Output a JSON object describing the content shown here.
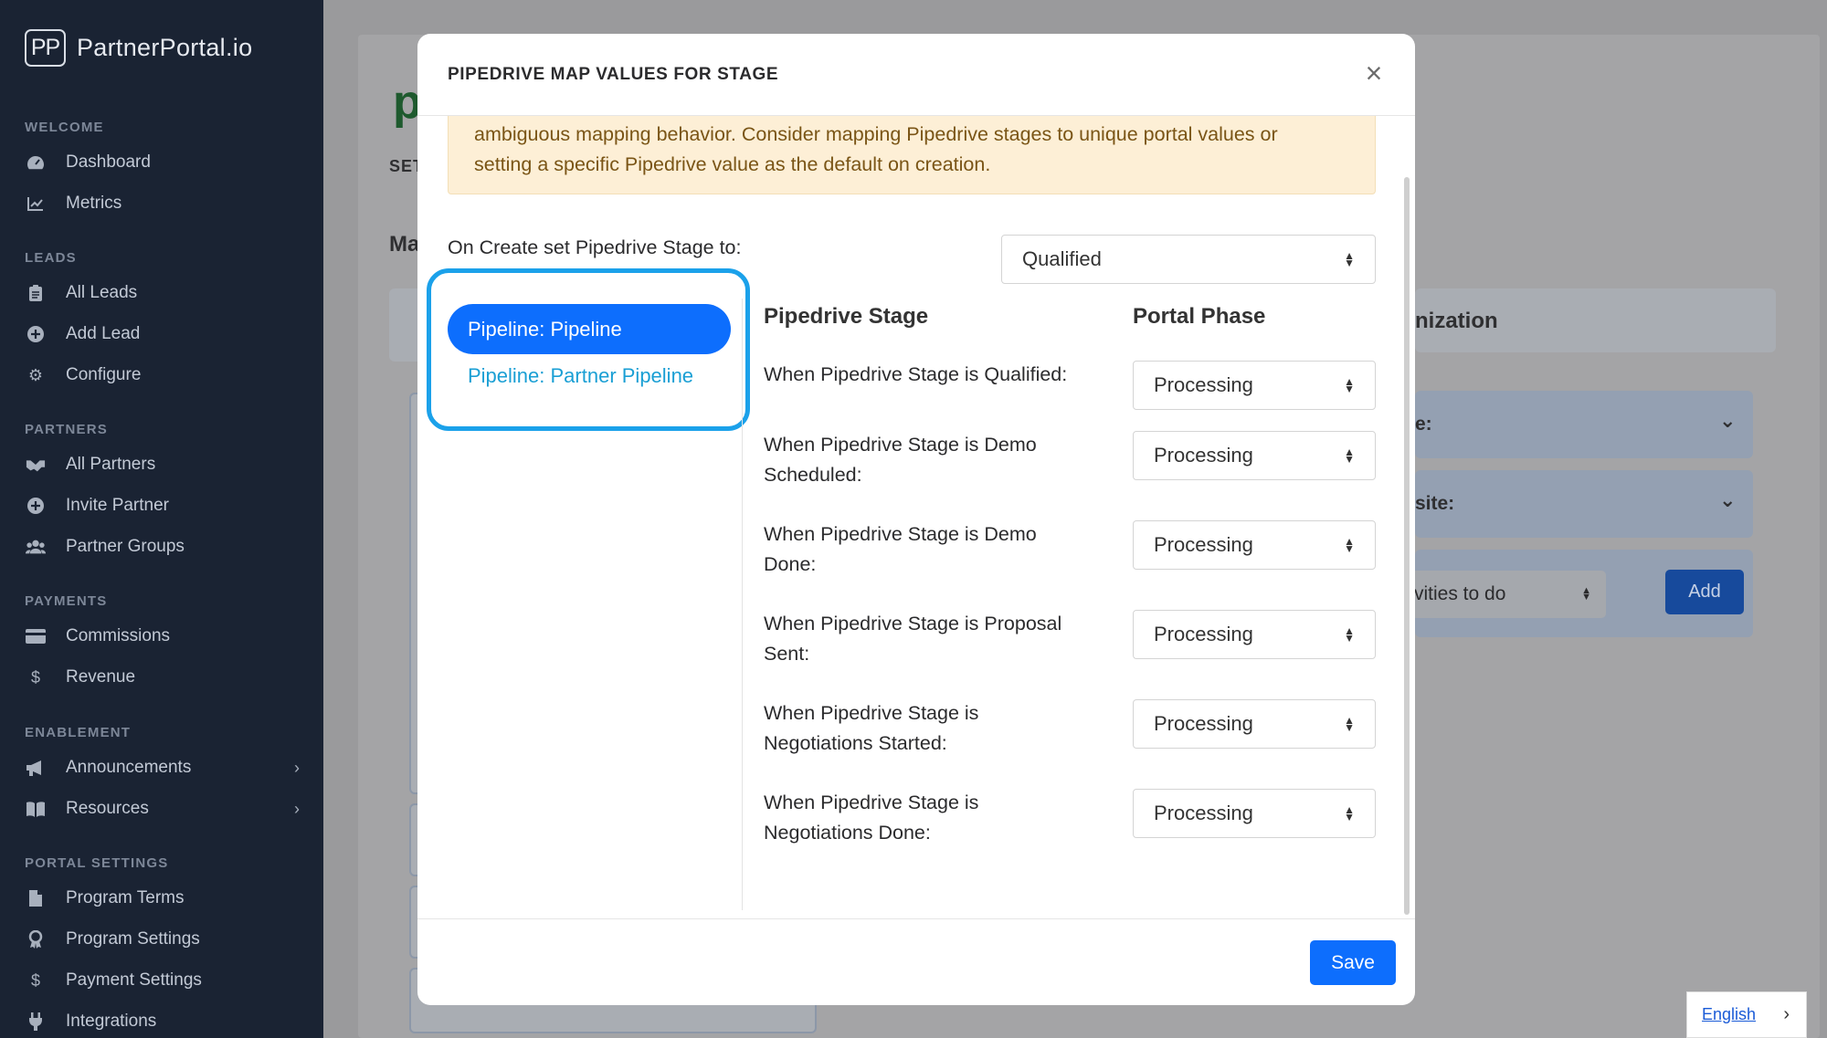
{
  "sidebar": {
    "brand_logo": "PP",
    "brand_name": "PartnerPortal.io",
    "sections": {
      "welcome": "WELCOME",
      "leads": "LEADS",
      "partners": "PARTNERS",
      "payments": "PAYMENTS",
      "enablement": "ENABLEMENT",
      "portal_settings": "PORTAL SETTINGS"
    },
    "items": {
      "dashboard": "Dashboard",
      "metrics": "Metrics",
      "all_leads": "All Leads",
      "add_lead": "Add Lead",
      "configure": "Configure",
      "all_partners": "All Partners",
      "invite_partner": "Invite Partner",
      "partner_groups": "Partner Groups",
      "commissions": "Commissions",
      "revenue": "Revenue",
      "announcements": "Announcements",
      "resources": "Resources",
      "program_terms": "Program Terms",
      "program_settings": "Program Settings",
      "payment_settings": "Payment Settings",
      "integrations": "Integrations"
    }
  },
  "background": {
    "title_fragment": "p",
    "tab_fragment": "SET",
    "heading_fragment": "Ma",
    "right_heading_fragment": "nization",
    "row1_fragment": "e:",
    "row2_fragment": "site:",
    "select_fragment": "vities to do",
    "add_label": "Add"
  },
  "modal": {
    "title": "PIPEDRIVE MAP VALUES FOR STAGE",
    "close_symbol": "×",
    "warning_line1": "ambiguous mapping behavior. Consider mapping Pipedrive stages to unique portal values or",
    "warning_line2": "setting a specific Pipedrive value as the default on creation.",
    "create_label": "On Create set Pipedrive Stage to:",
    "create_value": "Qualified",
    "pipelines": [
      "Pipeline: Pipeline",
      "Pipeline: Partner Pipeline"
    ],
    "col_stage": "Pipedrive Stage",
    "col_phase": "Portal Phase",
    "rows": [
      {
        "line1": "When Pipedrive Stage is Qualified:",
        "line2": "",
        "value": "Processing"
      },
      {
        "line1": "When Pipedrive Stage is Demo",
        "line2": "Scheduled:",
        "value": "Processing"
      },
      {
        "line1": "When Pipedrive Stage is Demo",
        "line2": "Done:",
        "value": "Processing"
      },
      {
        "line1": "When Pipedrive Stage is Proposal",
        "line2": "Sent:",
        "value": "Processing"
      },
      {
        "line1": "When Pipedrive Stage is",
        "line2": "Negotiations Started:",
        "value": "Processing"
      },
      {
        "line1": "When Pipedrive Stage is",
        "line2": "Negotiations Done:",
        "value": "Processing"
      }
    ],
    "save_label": "Save"
  },
  "language": {
    "label": "English"
  }
}
